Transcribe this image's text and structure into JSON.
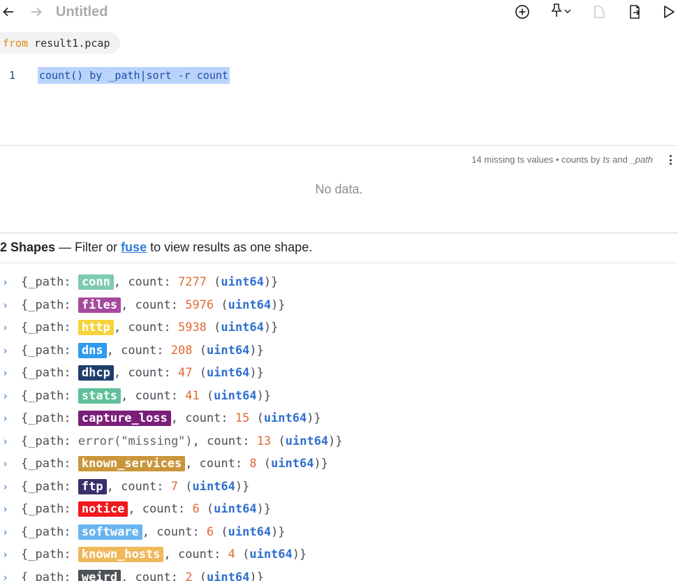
{
  "toolbar": {
    "title": "Untitled",
    "icons": [
      "arrow-left-icon",
      "arrow-right-icon",
      "add-circle-icon",
      "pin-icon",
      "chevron-down-icon",
      "file-icon",
      "export-icon",
      "play-icon"
    ]
  },
  "query": {
    "from_keyword": "from",
    "from_file": "result1.pcap",
    "line_number": "1",
    "code": "count() by _path|sort -r count"
  },
  "histogram": {
    "meta_prefix": "14 missing ts values • counts by ",
    "meta_field1": "ts",
    "meta_and": " and ",
    "meta_field2": "_path",
    "empty_text": "No data."
  },
  "shapes": {
    "count_label": "2 Shapes",
    "text_before": " — Filter or ",
    "link_label": "fuse",
    "text_after": " to view results as one shape."
  },
  "records": [
    {
      "path": "conn",
      "count": "7277",
      "type": "uint64",
      "color": "#7fcab0"
    },
    {
      "path": "files",
      "count": "5976",
      "type": "uint64",
      "color": "#a64a9e"
    },
    {
      "path": "http",
      "count": "5938",
      "type": "uint64",
      "color": "#f5d33a"
    },
    {
      "path": "dns",
      "count": "208",
      "type": "uint64",
      "color": "#2f9bef"
    },
    {
      "path": "dhcp",
      "count": "47",
      "type": "uint64",
      "color": "#1e3f6b"
    },
    {
      "path": "stats",
      "count": "41",
      "type": "uint64",
      "color": "#5fc09a"
    },
    {
      "path": "capture_loss",
      "count": "15",
      "type": "uint64",
      "color": "#7b1e7a"
    },
    {
      "path_error": "error(\"missing\")",
      "count": "13",
      "type": "uint64"
    },
    {
      "path": "known_services",
      "count": "8",
      "type": "uint64",
      "color": "#c9963b"
    },
    {
      "path": "ftp",
      "count": "7",
      "type": "uint64",
      "color": "#3a2f6b"
    },
    {
      "path": "notice",
      "count": "6",
      "type": "uint64",
      "color": "#f0181e"
    },
    {
      "path": "software",
      "count": "6",
      "type": "uint64",
      "color": "#6ab5ef"
    },
    {
      "path": "known_hosts",
      "count": "4",
      "type": "uint64",
      "color": "#f0b85a"
    },
    {
      "path": "weird",
      "count": "2",
      "type": "uint64",
      "color": "#4e5258"
    }
  ]
}
